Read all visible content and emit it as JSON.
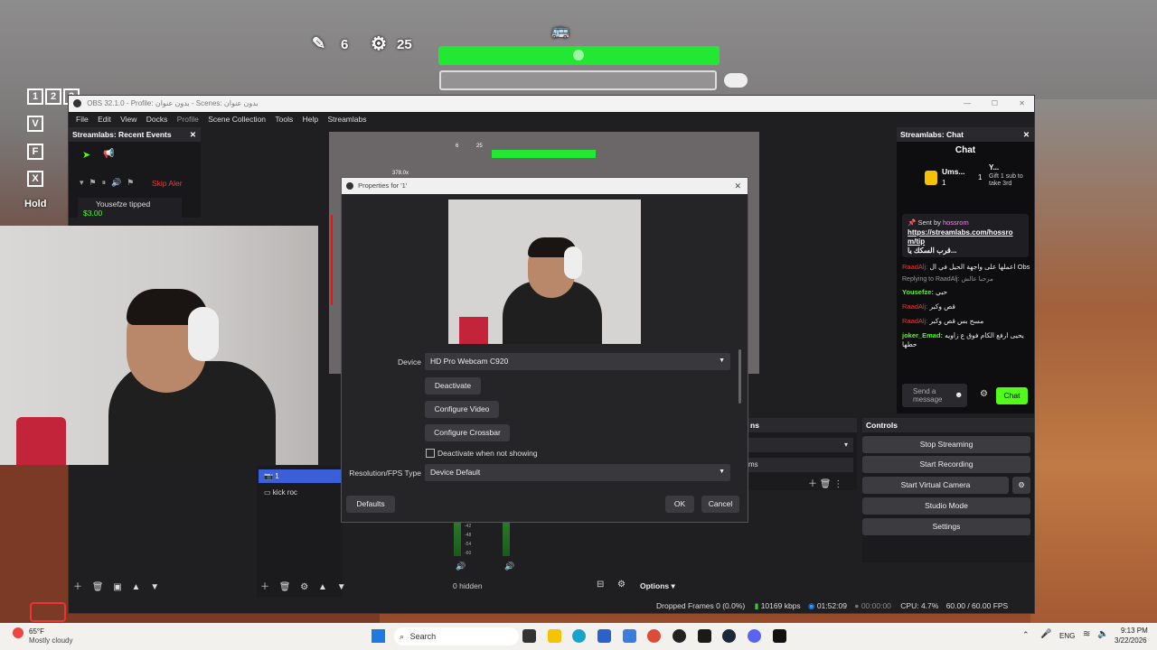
{
  "hud": {
    "pencil_count": "6",
    "ammo_count": "25",
    "key_rows": [
      "V",
      "F",
      "X"
    ],
    "key_numbers": [
      "1",
      "2",
      "3"
    ],
    "hold_label": "Hold",
    "health_color": "#22e833"
  },
  "obs": {
    "title": "OBS 32.1.0 - Profile: بدون عنوان - Scenes: بدون عنوان",
    "menu": [
      "File",
      "Edit",
      "View",
      "Docks",
      "Profile",
      "Scene Collection",
      "Tools",
      "Help",
      "Streamlabs"
    ],
    "recent_events": {
      "header": "Streamlabs: Recent Events",
      "skip_alerts": "Skip Aler",
      "event_name": "Yousefze tipped",
      "event_amount": "$3.00"
    },
    "chat": {
      "header": "Streamlabs: Chat",
      "title": "Chat",
      "top_user": "Ums...",
      "top_count": "1",
      "gift_user": "Y...",
      "gift_count": "1",
      "gift_text": "Gift 1 sub to take 3rd",
      "sent_by_label": "Sent by",
      "sent_by_user": "hossrom",
      "pinned_link": "https://streamlabs.com/hossrom/tip",
      "pinned_suffix": "قرب السكك يا...",
      "messages": [
        {
          "user": "RaadAlj:",
          "text": "اعملها على واجهة الحيل في ال Obs"
        },
        {
          "user": "Replying to RaadAlj:",
          "text": "مرحبا عالش"
        },
        {
          "user": "Yousefze:",
          "text": "حبي"
        },
        {
          "user": "RaadAlj:",
          "text": "قص وكبر"
        },
        {
          "user": "RaadAlj:",
          "text": "مسح بس قص وكبر"
        },
        {
          "user": "joker_Emad:",
          "text": "يحيى ارفع الكام فوق ع زاويه حطها"
        }
      ],
      "send_placeholder": "Send a message",
      "chat_button": "Chat",
      "accent": "#53fc18"
    },
    "sources": [
      {
        "name": "1",
        "selected": true
      },
      {
        "name": "kick roc",
        "selected": false
      }
    ],
    "controls": {
      "header": "Controls",
      "buttons": [
        "Stop Streaming",
        "Start Recording",
        "Start Virtual Camera",
        "Studio Mode",
        "Settings"
      ]
    },
    "mixer": {
      "ticks": [
        "-42",
        "-48",
        "-54",
        "-60"
      ],
      "hidden_label": "0 hidden",
      "options_label": "Options"
    },
    "transitions_fragment": {
      "header": "ns",
      "item": "ms"
    },
    "status": {
      "dropped_frames": "Dropped Frames 0 (0.0%)",
      "bitrate": "10169 kbps",
      "stream_time": "01:52:09",
      "rec_time": "00:00:00",
      "cpu": "CPU: 4.7%",
      "fps": "60.00 / 60.00 FPS"
    }
  },
  "dialog": {
    "title": "Properties for '1'",
    "device_label": "Device",
    "device_value": "HD Pro Webcam C920",
    "deactivate_button": "Deactivate",
    "configure_video_button": "Configure Video",
    "configure_crossbar_button": "Configure Crossbar",
    "deactivate_checkbox_label": "Deactivate when not showing",
    "resolution_label": "Resolution/FPS Type",
    "resolution_value": "Device Default",
    "defaults_button": "Defaults",
    "ok_button": "OK",
    "cancel_button": "Cancel"
  },
  "preview": {
    "hud_counts": [
      "6",
      "25"
    ],
    "size_readout": "378.0x"
  },
  "taskbar": {
    "weather_temp": "65°F",
    "weather_desc": "Mostly cloudy",
    "search_label": "Search",
    "language": "ENG",
    "time": "9:13 PM",
    "date": "3/22/2026"
  }
}
